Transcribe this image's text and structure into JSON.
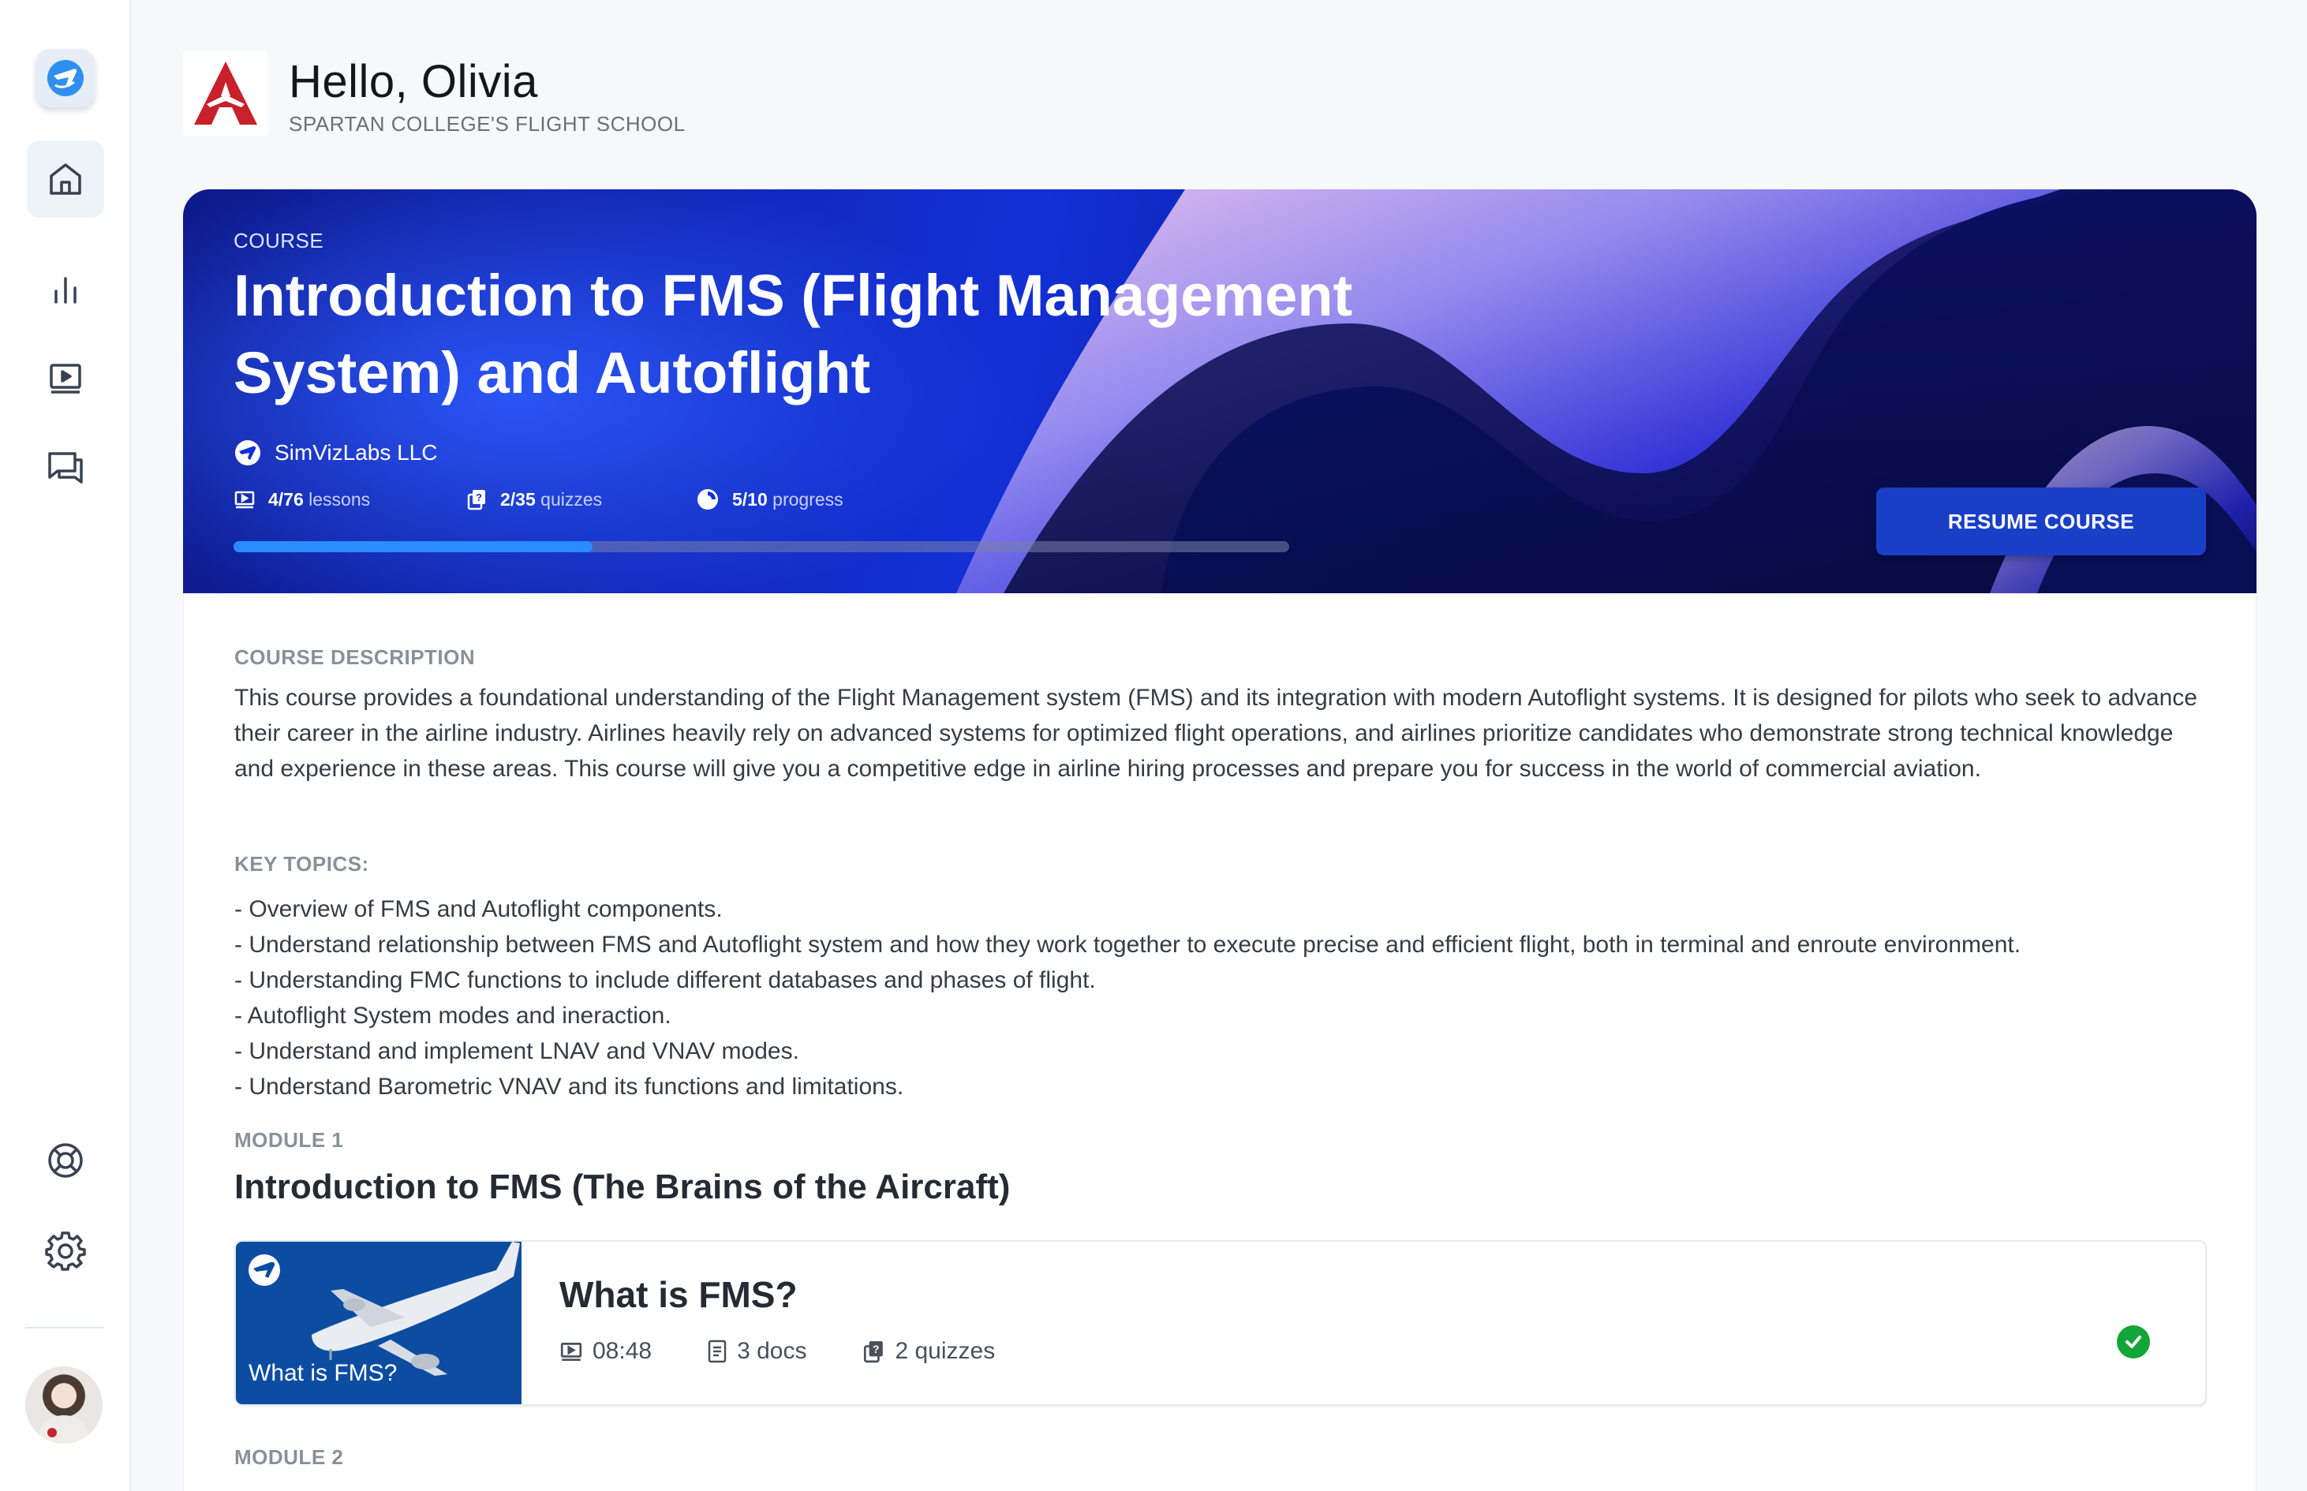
{
  "header": {
    "greeting": "Hello, Olivia",
    "school": "SPARTAN COLLEGE'S FLIGHT SCHOOL"
  },
  "sidebar": {
    "items": [
      {
        "icon": "home-icon",
        "active": true
      },
      {
        "icon": "bar-chart-icon",
        "active": false
      },
      {
        "icon": "video-icon",
        "active": false
      },
      {
        "icon": "chat-icon",
        "active": false
      },
      {
        "icon": "support-icon",
        "active": false
      },
      {
        "icon": "gear-icon",
        "active": false
      }
    ]
  },
  "hero": {
    "eyebrow": "COURSE",
    "title": "Introduction to FMS (Flight Management System) and Autoflight",
    "provider": "SimVizLabs LLC",
    "stats": {
      "lessons_value": "4/76",
      "lessons_label": "lessons",
      "quizzes_value": "2/35",
      "quizzes_label": "quizzes",
      "progress_value": "5/10",
      "progress_label": "progress"
    },
    "progress_fraction": 0.34,
    "resume_label": "RESUME COURSE"
  },
  "content": {
    "description_label": "COURSE DESCRIPTION",
    "description": "This course provides a foundational understanding of the Flight Management system (FMS) and its integration with modern Autoflight systems. It is designed for pilots who seek to advance their career in the airline industry. Airlines heavily rely on advanced systems for optimized flight operations, and airlines prioritize candidates who demonstrate strong technical knowledge and experience in these areas. This course will give you a competitive edge in airline hiring processes and prepare you for success in the world of commercial aviation.",
    "topics_label": "KEY TOPICS:",
    "topics": [
      "- Overview of FMS and Autoflight components.",
      "- Understand relationship between FMS and Autoflight system and how they work together to execute precise and efficient flight, both in terminal and enroute environment.",
      "- Understanding FMC functions to include different databases and phases of flight.",
      "- Autoflight System modes and ineraction.",
      "- Understand and implement LNAV and VNAV modes.",
      "- Understand Barometric VNAV and its functions and limitations."
    ],
    "module1_label": "MODULE 1",
    "module1_title": "Introduction to FMS (The Brains of the Aircraft)",
    "lesson": {
      "thumb_caption": "What is FMS?",
      "title": "What is FMS?",
      "duration": "08:48",
      "docs": "3 docs",
      "quizzes": "2 quizzes",
      "completed": true
    },
    "module2_label": "MODULE 2"
  },
  "colors": {
    "accent": "#2a8cff",
    "button": "#1a3fc7",
    "complete": "#12a538",
    "brand_red": "#c8202c"
  }
}
